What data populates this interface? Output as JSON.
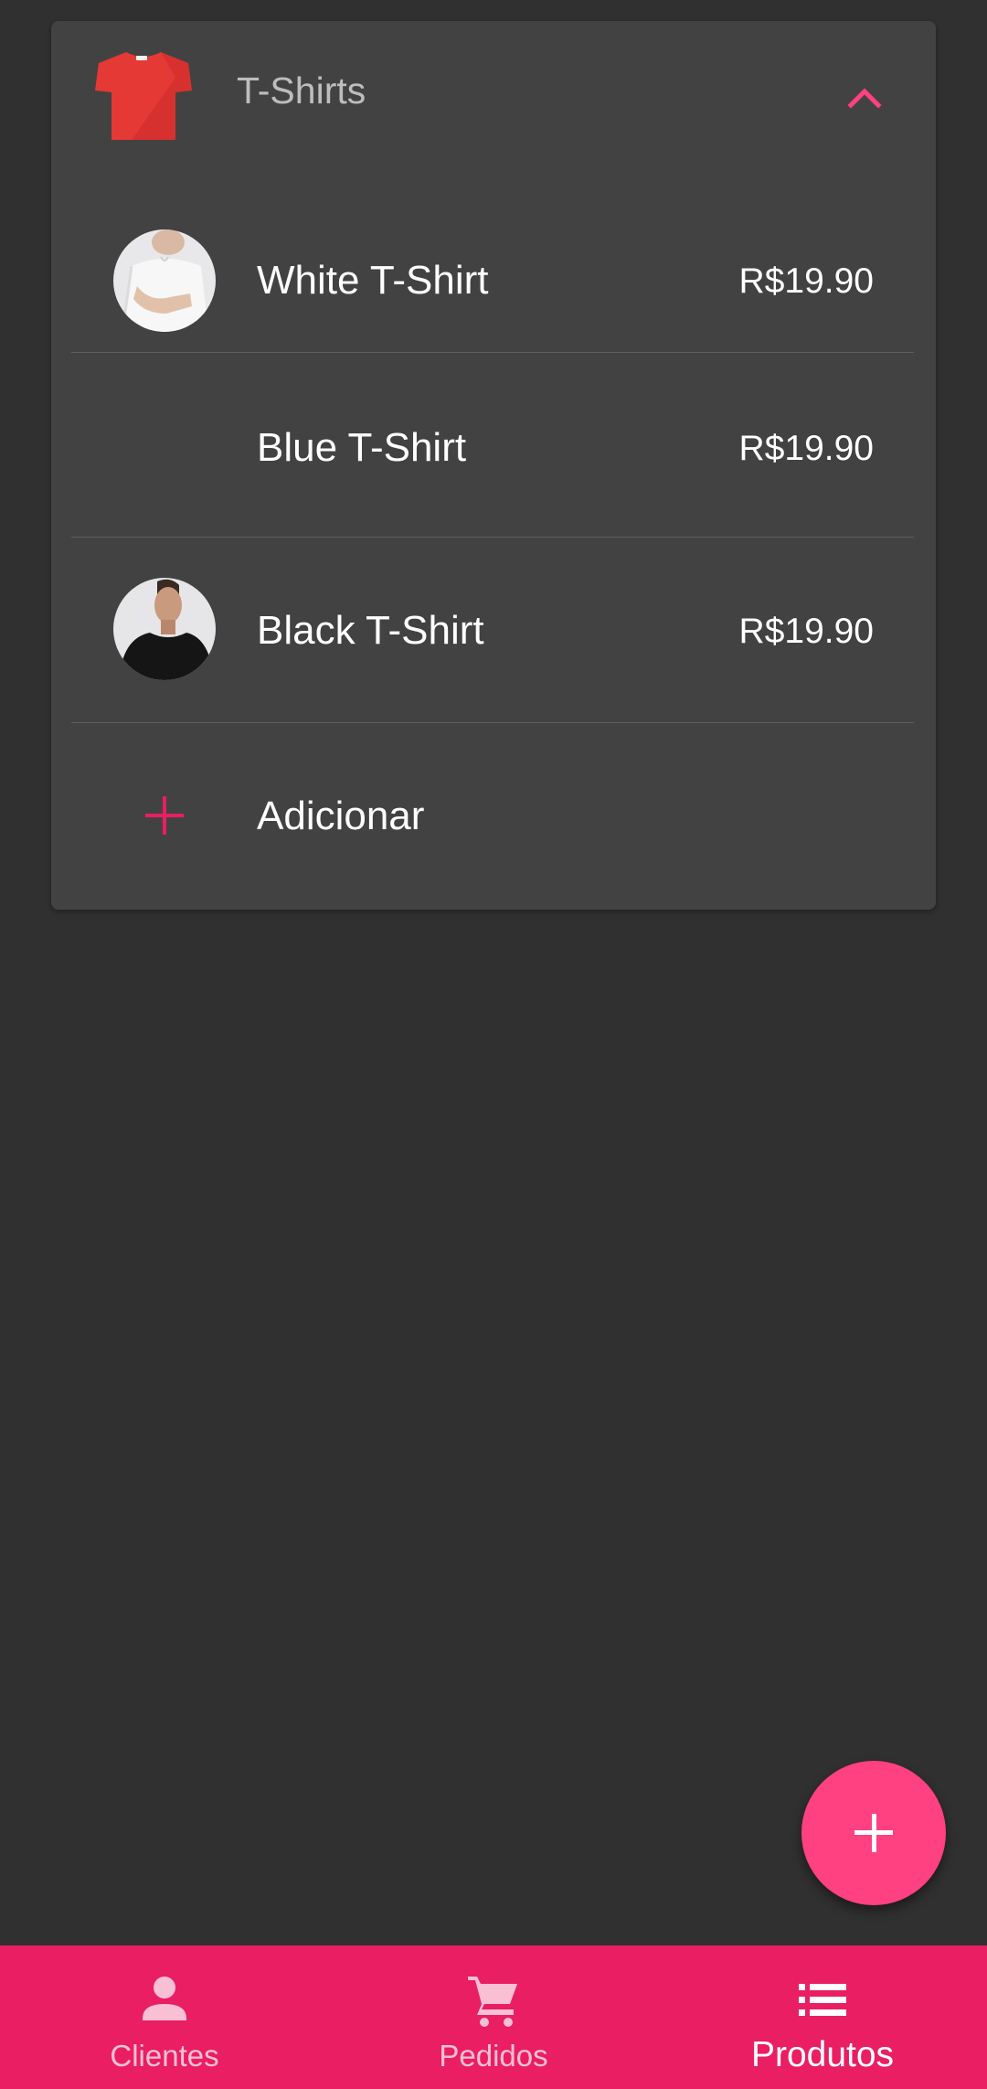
{
  "category": {
    "title": "T-Shirts",
    "icon": "t-shirt-icon",
    "expanded": true
  },
  "products": [
    {
      "name": "White T-Shirt",
      "price": "R$19.90",
      "image": "white-t-shirt-photo"
    },
    {
      "name": "Blue T-Shirt",
      "price": "R$19.90",
      "image": ""
    },
    {
      "name": "Black T-Shirt",
      "price": "R$19.90",
      "image": "black-t-shirt-photo"
    }
  ],
  "add_item": {
    "label": "Adicionar",
    "icon": "plus-icon"
  },
  "fab": {
    "icon": "plus-icon"
  },
  "bottom_nav": {
    "items": [
      {
        "label": "Clientes",
        "icon": "person-icon",
        "active": false
      },
      {
        "label": "Pedidos",
        "icon": "cart-icon",
        "active": false
      },
      {
        "label": "Produtos",
        "icon": "list-icon",
        "active": true
      }
    ]
  },
  "colors": {
    "background": "#303030",
    "card": "#424242",
    "accent": "#ff4081",
    "nav_bar": "#e91e63",
    "icon_red": "#e53935"
  }
}
